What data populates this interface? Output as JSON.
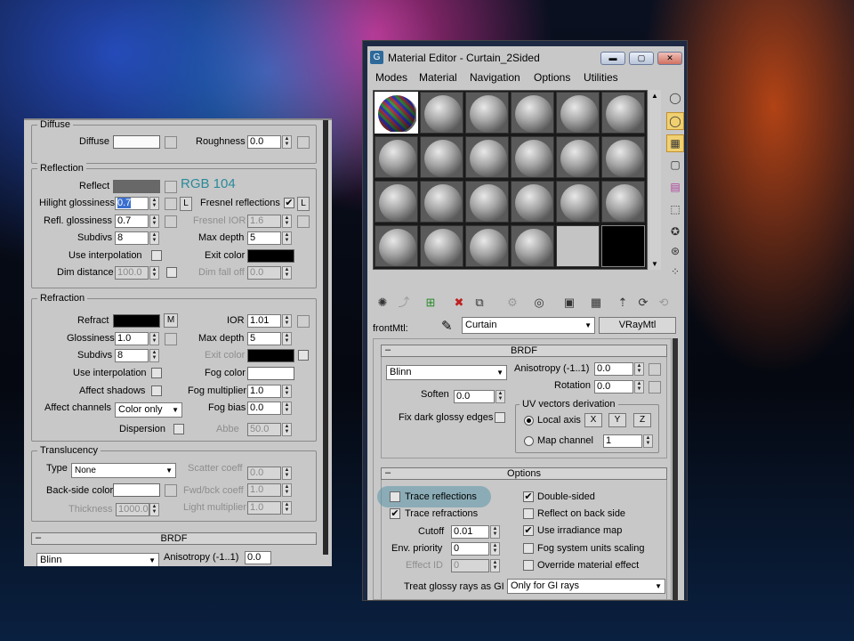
{
  "left": {
    "diffuse": {
      "title": "Diffuse",
      "diffuse": "Diffuse",
      "roughness": "Roughness",
      "roughness_val": "0.0"
    },
    "reflection": {
      "title": "Reflection",
      "reflect": "Reflect",
      "rgb_note": "RGB 104",
      "hilight": "Hilight glossiness",
      "hilight_val": "0.7",
      "lock": "L",
      "fresnel": "Fresnel reflections",
      "refl_gloss": "Refl. glossiness",
      "refl_gloss_val": "0.7",
      "fresnel_ior": "Fresnel IOR",
      "fresnel_ior_val": "1.6",
      "subdivs": "Subdivs",
      "subdivs_val": "8",
      "max_depth": "Max depth",
      "max_depth_val": "5",
      "use_interp": "Use interpolation",
      "exit_color": "Exit color",
      "dim_distance": "Dim distance",
      "dim_distance_val": "100.0",
      "dim_falloff": "Dim fall off",
      "dim_falloff_val": "0.0"
    },
    "refraction": {
      "title": "Refraction",
      "refract": "Refract",
      "m": "M",
      "ior": "IOR",
      "ior_val": "1.01",
      "glossiness": "Glossiness",
      "gloss_val": "1.0",
      "max_depth": "Max depth",
      "max_depth_val": "5",
      "subdivs": "Subdivs",
      "subdivs_val": "8",
      "exit_color": "Exit color",
      "use_interp": "Use interpolation",
      "fog_color": "Fog color",
      "affect_shadows": "Affect shadows",
      "fog_mult": "Fog multiplier",
      "fog_mult_val": "1.0",
      "affect_channels": "Affect channels",
      "affect_channels_val": "Color only",
      "fog_bias": "Fog bias",
      "fog_bias_val": "0.0",
      "dispersion": "Dispersion",
      "abbe": "Abbe",
      "abbe_val": "50.0"
    },
    "translucency": {
      "title": "Translucency",
      "type": "Type",
      "type_val": "None",
      "scatter": "Scatter coeff",
      "scatter_val": "0.0",
      "backside": "Back-side color",
      "fwd": "Fwd/bck coeff",
      "fwd_val": "1.0",
      "thickness": "Thickness",
      "thickness_val": "1000.0",
      "light_mult": "Light multiplier",
      "light_mult_val": "1.0"
    },
    "brdf": {
      "title": "BRDF",
      "type_val": "Blinn",
      "aniso": "Anisotropy (-1..1)",
      "aniso_val": "0.0"
    }
  },
  "editor": {
    "title": "Material Editor - Curtain_2Sided",
    "menus": [
      "Modes",
      "Material",
      "Navigation",
      "Options",
      "Utilities"
    ],
    "front_mtl": "frontMtl:",
    "mtl_name": "Curtain",
    "mtl_type": "VRayMtl",
    "brdf": {
      "title": "BRDF",
      "type_val": "Blinn",
      "aniso": "Anisotropy (-1..1)",
      "aniso_val": "0.0",
      "rotation": "Rotation",
      "rotation_val": "0.0",
      "soften": "Soften",
      "soften_val": "0.0",
      "fix_dark": "Fix dark glossy edges",
      "uv_title": "UV vectors derivation",
      "local_axis": "Local axis",
      "x": "X",
      "y": "Y",
      "z": "Z",
      "map_channel": "Map channel",
      "map_channel_val": "1"
    },
    "options": {
      "title": "Options",
      "trace_refl": "Trace reflections",
      "double_sided": "Double-sided",
      "trace_refr": "Trace refractions",
      "reflect_back": "Reflect on back side",
      "cutoff": "Cutoff",
      "cutoff_val": "0.01",
      "use_irr": "Use irradiance map",
      "env_priority": "Env. priority",
      "env_priority_val": "0",
      "fog_units": "Fog system units scaling",
      "effect_id": "Effect ID",
      "effect_id_val": "0",
      "override": "Override material effect",
      "treat_glossy": "Treat glossy rays as GI",
      "treat_glossy_val": "Only for GI rays"
    }
  }
}
